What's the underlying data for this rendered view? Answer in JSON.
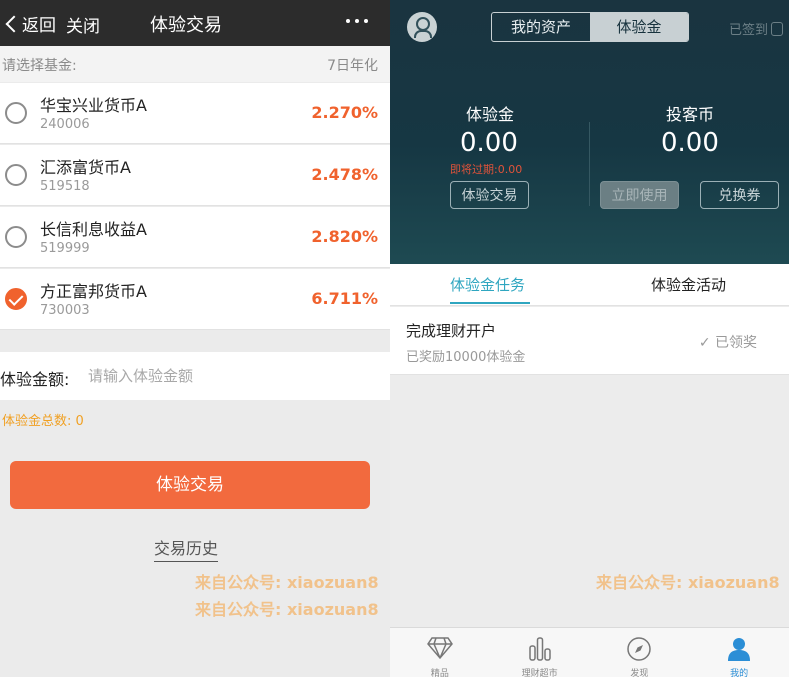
{
  "left": {
    "topbar": {
      "back_label": "返回",
      "close_label": "关闭",
      "title": "体验交易",
      "more_icon": "more-dots-icon"
    },
    "fund_header": {
      "label": "请选择基金:",
      "rate_header": "7日年化"
    },
    "funds": [
      {
        "name": "华宝兴业货币A",
        "code": "240006",
        "rate": "2.270%",
        "selected": false
      },
      {
        "name": "汇添富货币A",
        "code": "519518",
        "rate": "2.478%",
        "selected": false
      },
      {
        "name": "长信利息收益A",
        "code": "519999",
        "rate": "2.820%",
        "selected": false
      },
      {
        "name": "方正富邦货币A",
        "code": "730003",
        "rate": "6.711%",
        "selected": true
      }
    ],
    "amount": {
      "label": "体验金额:",
      "value": "",
      "placeholder": "请输入体验金额"
    },
    "total": "体验金总数: 0",
    "trade_button": "体验交易",
    "history_link": "交易历史",
    "watermark_1": "来自公众号: xiaozuan8",
    "watermark_2": "来自公众号: xiaozuan8"
  },
  "right": {
    "segments": {
      "assets": "我的资产",
      "experience": "体验金",
      "active": "experience"
    },
    "signed_label": "已签到",
    "experience": {
      "label": "体验金",
      "value": "0.00",
      "expiring": "即将过期:0.00",
      "button": "体验交易"
    },
    "coins": {
      "label": "投客币",
      "value": "0.00",
      "use_button": "立即使用",
      "redeem_button": "兑换券"
    },
    "tabs": {
      "tasks": "体验金任务",
      "activities": "体验金活动",
      "active": "tasks"
    },
    "task": {
      "title": "完成理财开户",
      "subtitle": "已奖励10000体验金",
      "status": "已领奖"
    },
    "watermark": "来自公众号: xiaozuan8",
    "nav": [
      {
        "label": "精品",
        "icon": "diamond-icon",
        "active": false
      },
      {
        "label": "理财超市",
        "icon": "bar-chart-icon",
        "active": false
      },
      {
        "label": "发现",
        "icon": "compass-icon",
        "active": false
      },
      {
        "label": "我的",
        "icon": "person-icon",
        "active": true
      }
    ],
    "colors": {
      "accent": "#2fa6c0",
      "orange": "#f26a3e",
      "hero_bg": "#163743",
      "active_nav": "#2b8ed6"
    }
  }
}
